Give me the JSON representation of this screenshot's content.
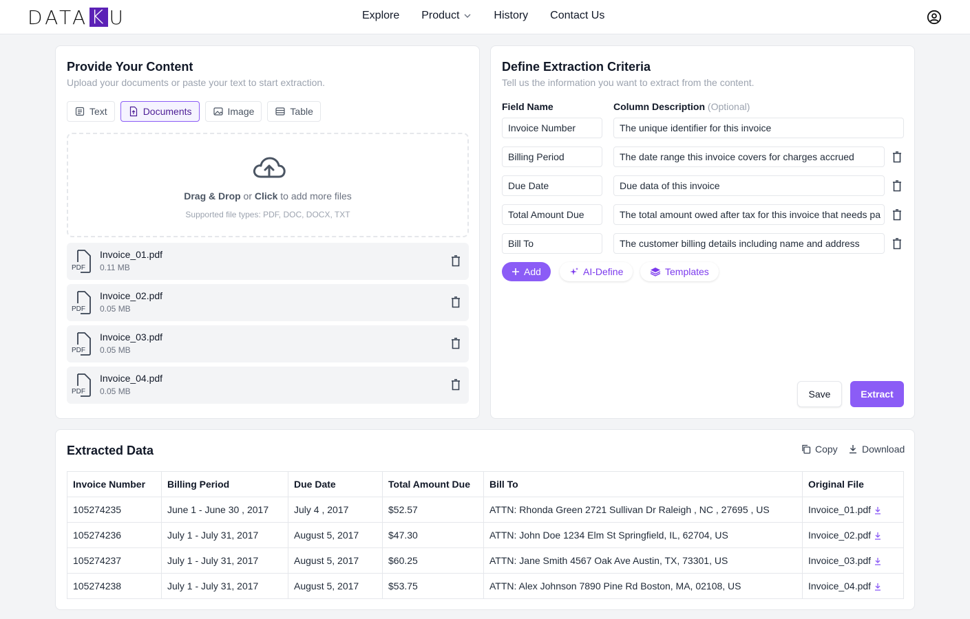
{
  "nav": {
    "logo_pre": "DATA",
    "logo_hl": "K",
    "logo_post": "U",
    "links": [
      "Explore",
      "Product",
      "History",
      "Contact Us"
    ],
    "account_icon": "user-circle-icon"
  },
  "content": {
    "title": "Provide Your Content",
    "subtitle": "Upload your documents or paste your text to start extraction.",
    "tabs": [
      "Text",
      "Documents",
      "Image",
      "Table"
    ],
    "active_tab": "Documents",
    "drop_bold1": "Drag & Drop",
    "drop_or": " or ",
    "drop_bold2": "Click",
    "drop_rest": " to add more files",
    "supported": "Supported file types: PDF, DOC, DOCX, TXT",
    "files": [
      {
        "name": "Invoice_01.pdf",
        "size": "0.11 MB"
      },
      {
        "name": "Invoice_02.pdf",
        "size": "0.05 MB"
      },
      {
        "name": "Invoice_03.pdf",
        "size": "0.05 MB"
      },
      {
        "name": "Invoice_04.pdf",
        "size": "0.05 MB"
      }
    ],
    "pdf_label": "PDF"
  },
  "criteria": {
    "title": "Define Extraction Criteria",
    "subtitle": "Tell us the information you want to extract from the content.",
    "field_name_header": "Field Name",
    "col_desc_header": "Column Description",
    "optional": "(Optional)",
    "rows": [
      {
        "field": "Invoice Number",
        "desc": "The unique identifier for this invoice"
      },
      {
        "field": "Billing Period",
        "desc": "The date range this invoice covers for charges accrued"
      },
      {
        "field": "Due Date",
        "desc": "Due data of this invoice"
      },
      {
        "field": "Total Amount Due",
        "desc": "The total amount owed after tax for this invoice that needs pa"
      },
      {
        "field": "Bill To",
        "desc": "The customer billing details including name and address"
      }
    ],
    "add_label": "Add",
    "ai_define_label": "AI-Define",
    "templates_label": "Templates",
    "save_label": "Save",
    "extract_label": "Extract"
  },
  "extracted": {
    "title": "Extracted Data",
    "copy_label": "Copy",
    "download_label": "Download",
    "columns": [
      "Invoice Number",
      "Billing Period",
      "Due Date",
      "Total Amount Due",
      "Bill To",
      "Original File"
    ],
    "rows": [
      [
        "105274235",
        "June 1 - June 30 , 2017",
        "July 4 , 2017",
        "$52.57",
        "ATTN: Rhonda Green 2721 Sullivan Dr Raleigh , NC , 27695 , US",
        "Invoice_01.pdf"
      ],
      [
        "105274236",
        "July 1 - July 31, 2017",
        "August 5, 2017",
        "$47.30",
        "ATTN: John Doe 1234 Elm St Springfield, IL, 62704, US",
        "Invoice_02.pdf"
      ],
      [
        "105274237",
        "July 1 - July 31, 2017",
        "August 5, 2017",
        "$60.25",
        "ATTN: Jane Smith 4567 Oak Ave Austin, TX, 73301, US",
        "Invoice_03.pdf"
      ],
      [
        "105274238",
        "July 1 - July 31, 2017",
        "August 5, 2017",
        "$53.75",
        "ATTN: Alex Johnson 7890 Pine Rd Boston, MA, 02108, US",
        "Invoice_04.pdf"
      ]
    ]
  },
  "colors": {
    "accent": "#8b5cf6",
    "accent_dark": "#5b21b6"
  }
}
